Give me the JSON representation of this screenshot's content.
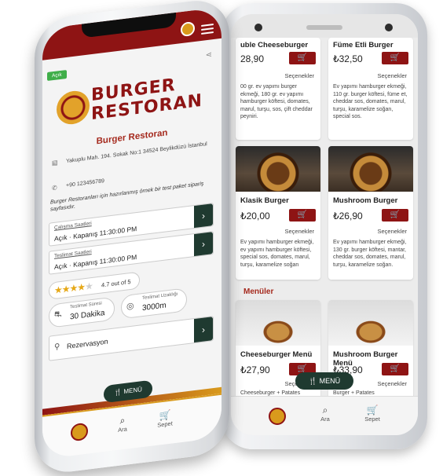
{
  "back_phone": {
    "cards_top": [
      {
        "title": "uble Cheeseburger",
        "price": "28,90",
        "options": "Seçenekler",
        "desc": "00 gr. ev yapımı burger ekmeği, 180 gr. ev yapımı hamburger köftesi, domates, marul, turşu, sos, çift cheddar peyniri."
      },
      {
        "title": "Füme Etli Burger",
        "price": "₺32,50",
        "options": "Seçenekler",
        "desc": "Ev yapımı hamburger ekmeği, 110 gr. burger köftesi, füme et, cheddar sos, domates, marul, turşu, karamelize soğan, special sos."
      }
    ],
    "cards_mid": [
      {
        "title": "Klasik Burger",
        "price": "₺20,00",
        "options": "Seçenekler",
        "desc": "Ev yapımı hamburger ekmeği, ev yapımı hamburger köftesi, special sos, domates, marul, turşu, karamelize soğan"
      },
      {
        "title": "Mushroom Burger",
        "price": "₺26,90",
        "options": "Seçenekler",
        "desc": "Ev yapımı hamburger ekmeği, 130 gr. burger köftesi, mantar, cheddar sos, domates, marul, turşu, karamelize soğan."
      }
    ],
    "section_title": "Menüler",
    "cards_bottom": [
      {
        "title": "Cheeseburger Menü",
        "price": "₺27,90",
        "options": "Seçenekler",
        "desc": "Cheeseburger + Patates"
      },
      {
        "title": "Mushroom Burger Menü",
        "price": "₺33,90",
        "options": "Seçenekler",
        "desc": "Burger + Patates"
      }
    ],
    "menu_button": "MENÜ",
    "nav": {
      "search": "Ara",
      "cart": "Sepet"
    },
    "cart_icon": "cart-icon"
  },
  "front_phone": {
    "status_badge": "Açık",
    "brand_line1": "BURGER",
    "brand_line2": "RESTORAN",
    "restaurant_name": "Burger Restoran",
    "address": "Yakuplu Mah. 194. Sokak No:1 34524 Beylikdüzü İstanbul",
    "phone": "+90 123456789",
    "intro": "Burger Restoranları için hazırlanmış örnek bir test paket sipariş sayfasıdır.",
    "working_hours": {
      "label": "Çalışma Saatleri",
      "value": "Açık · Kapanış 11:30:00 PM"
    },
    "delivery_hours": {
      "label": "Teslimat Saatleri",
      "value": "Açık · Kapanış 11:30:00 PM"
    },
    "rating": {
      "stars": 4,
      "max": 5,
      "text": "4.7 out of 5"
    },
    "delivery_time": {
      "label": "Teslimat Süresi",
      "value": "30 Dakika"
    },
    "delivery_distance": {
      "label": "Teslimat Uzaklığı",
      "value": "3000m"
    },
    "reservation": "Rezervasyon",
    "menu_button": "MENÜ",
    "nav": {
      "search": "Ara",
      "cart": "Sepet"
    }
  },
  "colors": {
    "brand_red": "#8e1414",
    "accent_green": "#1f3a30",
    "gold": "#d99a1c",
    "open_green": "#3fae49"
  }
}
